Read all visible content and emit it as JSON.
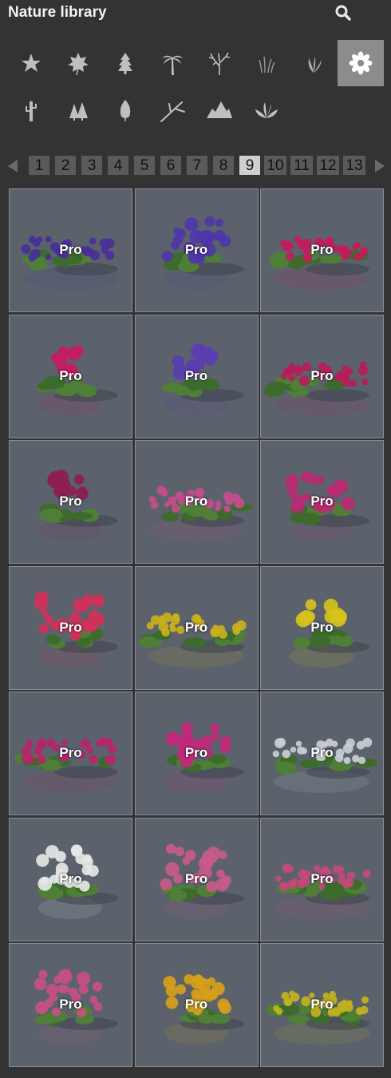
{
  "header": {
    "title": "Nature library",
    "search_icon": "search-icon"
  },
  "categories": [
    {
      "icon": "star-icon",
      "active": false
    },
    {
      "icon": "maple-leaf-icon",
      "active": false
    },
    {
      "icon": "conifer-tree-icon",
      "active": false
    },
    {
      "icon": "palm-tree-icon",
      "active": false
    },
    {
      "icon": "bare-tree-icon",
      "active": false
    },
    {
      "icon": "grass-icon",
      "active": false
    },
    {
      "icon": "fern-leaves-icon",
      "active": false
    },
    {
      "icon": "flower-icon",
      "active": true
    },
    {
      "icon": "cactus-icon",
      "active": false
    },
    {
      "icon": "forest-icon",
      "active": false
    },
    {
      "icon": "leaf-icon",
      "active": false
    },
    {
      "icon": "branch-icon",
      "active": false
    },
    {
      "icon": "mountains-icon",
      "active": false
    },
    {
      "icon": "broad-plant-icon",
      "active": false
    }
  ],
  "pagination": {
    "prev_icon": "arrow-left-icon",
    "next_icon": "arrow-right-icon",
    "pages": [
      "1",
      "2",
      "3",
      "4",
      "5",
      "6",
      "7",
      "8",
      "9",
      "10",
      "11",
      "12",
      "13"
    ],
    "current": "9"
  },
  "colors": {
    "background": "#333333",
    "tile": "#5b626c",
    "active_category": "#8c8c8c",
    "active_page": "#cfcfcf"
  },
  "items": [
    {
      "badge": "Pro",
      "flower_color": "#4a2f9a",
      "style": "bed"
    },
    {
      "badge": "Pro",
      "flower_color": "#4f36a8",
      "style": "bush"
    },
    {
      "badge": "Pro",
      "flower_color": "#c21c5c",
      "style": "bed"
    },
    {
      "badge": "Pro",
      "flower_color": "#c41c62",
      "style": "plant"
    },
    {
      "badge": "Pro",
      "flower_color": "#5a3db2",
      "style": "plant"
    },
    {
      "badge": "Pro",
      "flower_color": "#b51d5a",
      "style": "bed"
    },
    {
      "badge": "Pro",
      "flower_color": "#8c1e52",
      "style": "plant"
    },
    {
      "badge": "Pro",
      "flower_color": "#c44c8c",
      "style": "bed"
    },
    {
      "badge": "Pro",
      "flower_color": "#b82a72",
      "style": "bush"
    },
    {
      "badge": "Pro",
      "flower_color": "#d2305a",
      "style": "bush"
    },
    {
      "badge": "Pro",
      "flower_color": "#c9b01e",
      "style": "bed"
    },
    {
      "badge": "Pro",
      "flower_color": "#d6c21a",
      "style": "plant"
    },
    {
      "badge": "Pro",
      "flower_color": "#b8246e",
      "style": "bed"
    },
    {
      "badge": "Pro",
      "flower_color": "#c2287a",
      "style": "bush"
    },
    {
      "badge": "Pro",
      "flower_color": "#c8cdd4",
      "style": "bed"
    },
    {
      "badge": "Pro",
      "flower_color": "#e6e6e6",
      "style": "bush"
    },
    {
      "badge": "Pro",
      "flower_color": "#c85a8a",
      "style": "bush"
    },
    {
      "badge": "Pro",
      "flower_color": "#c24a7a",
      "style": "bed"
    },
    {
      "badge": "Pro",
      "flower_color": "#c84f84",
      "style": "bush"
    },
    {
      "badge": "Pro",
      "flower_color": "#d6a01a",
      "style": "bush"
    },
    {
      "badge": "Pro",
      "flower_color": "#c2b21e",
      "style": "bed"
    }
  ]
}
